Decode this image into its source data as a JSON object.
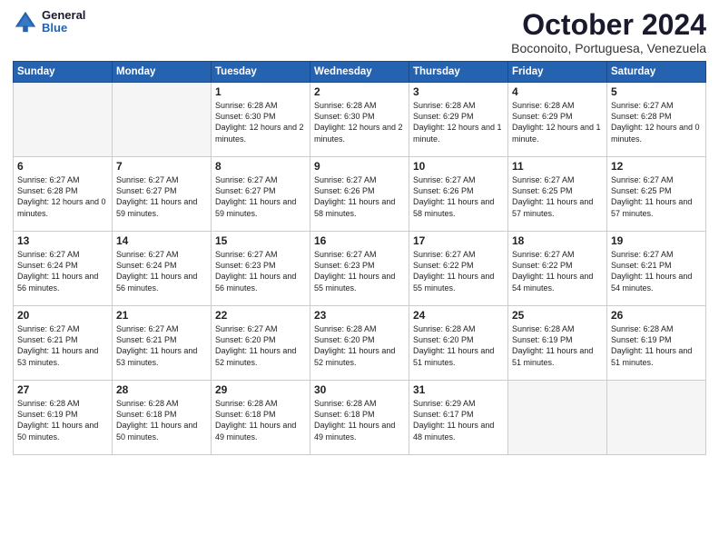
{
  "logo": {
    "general": "General",
    "blue": "Blue"
  },
  "header": {
    "month_title": "October 2024",
    "subtitle": "Boconoito, Portuguesa, Venezuela"
  },
  "days_of_week": [
    "Sunday",
    "Monday",
    "Tuesday",
    "Wednesday",
    "Thursday",
    "Friday",
    "Saturday"
  ],
  "weeks": [
    [
      {
        "day": "",
        "info": ""
      },
      {
        "day": "",
        "info": ""
      },
      {
        "day": "1",
        "info": "Sunrise: 6:28 AM\nSunset: 6:30 PM\nDaylight: 12 hours and 2 minutes."
      },
      {
        "day": "2",
        "info": "Sunrise: 6:28 AM\nSunset: 6:30 PM\nDaylight: 12 hours and 2 minutes."
      },
      {
        "day": "3",
        "info": "Sunrise: 6:28 AM\nSunset: 6:29 PM\nDaylight: 12 hours and 1 minute."
      },
      {
        "day": "4",
        "info": "Sunrise: 6:28 AM\nSunset: 6:29 PM\nDaylight: 12 hours and 1 minute."
      },
      {
        "day": "5",
        "info": "Sunrise: 6:27 AM\nSunset: 6:28 PM\nDaylight: 12 hours and 0 minutes."
      }
    ],
    [
      {
        "day": "6",
        "info": "Sunrise: 6:27 AM\nSunset: 6:28 PM\nDaylight: 12 hours and 0 minutes."
      },
      {
        "day": "7",
        "info": "Sunrise: 6:27 AM\nSunset: 6:27 PM\nDaylight: 11 hours and 59 minutes."
      },
      {
        "day": "8",
        "info": "Sunrise: 6:27 AM\nSunset: 6:27 PM\nDaylight: 11 hours and 59 minutes."
      },
      {
        "day": "9",
        "info": "Sunrise: 6:27 AM\nSunset: 6:26 PM\nDaylight: 11 hours and 58 minutes."
      },
      {
        "day": "10",
        "info": "Sunrise: 6:27 AM\nSunset: 6:26 PM\nDaylight: 11 hours and 58 minutes."
      },
      {
        "day": "11",
        "info": "Sunrise: 6:27 AM\nSunset: 6:25 PM\nDaylight: 11 hours and 57 minutes."
      },
      {
        "day": "12",
        "info": "Sunrise: 6:27 AM\nSunset: 6:25 PM\nDaylight: 11 hours and 57 minutes."
      }
    ],
    [
      {
        "day": "13",
        "info": "Sunrise: 6:27 AM\nSunset: 6:24 PM\nDaylight: 11 hours and 56 minutes."
      },
      {
        "day": "14",
        "info": "Sunrise: 6:27 AM\nSunset: 6:24 PM\nDaylight: 11 hours and 56 minutes."
      },
      {
        "day": "15",
        "info": "Sunrise: 6:27 AM\nSunset: 6:23 PM\nDaylight: 11 hours and 56 minutes."
      },
      {
        "day": "16",
        "info": "Sunrise: 6:27 AM\nSunset: 6:23 PM\nDaylight: 11 hours and 55 minutes."
      },
      {
        "day": "17",
        "info": "Sunrise: 6:27 AM\nSunset: 6:22 PM\nDaylight: 11 hours and 55 minutes."
      },
      {
        "day": "18",
        "info": "Sunrise: 6:27 AM\nSunset: 6:22 PM\nDaylight: 11 hours and 54 minutes."
      },
      {
        "day": "19",
        "info": "Sunrise: 6:27 AM\nSunset: 6:21 PM\nDaylight: 11 hours and 54 minutes."
      }
    ],
    [
      {
        "day": "20",
        "info": "Sunrise: 6:27 AM\nSunset: 6:21 PM\nDaylight: 11 hours and 53 minutes."
      },
      {
        "day": "21",
        "info": "Sunrise: 6:27 AM\nSunset: 6:21 PM\nDaylight: 11 hours and 53 minutes."
      },
      {
        "day": "22",
        "info": "Sunrise: 6:27 AM\nSunset: 6:20 PM\nDaylight: 11 hours and 52 minutes."
      },
      {
        "day": "23",
        "info": "Sunrise: 6:28 AM\nSunset: 6:20 PM\nDaylight: 11 hours and 52 minutes."
      },
      {
        "day": "24",
        "info": "Sunrise: 6:28 AM\nSunset: 6:20 PM\nDaylight: 11 hours and 51 minutes."
      },
      {
        "day": "25",
        "info": "Sunrise: 6:28 AM\nSunset: 6:19 PM\nDaylight: 11 hours and 51 minutes."
      },
      {
        "day": "26",
        "info": "Sunrise: 6:28 AM\nSunset: 6:19 PM\nDaylight: 11 hours and 51 minutes."
      }
    ],
    [
      {
        "day": "27",
        "info": "Sunrise: 6:28 AM\nSunset: 6:19 PM\nDaylight: 11 hours and 50 minutes."
      },
      {
        "day": "28",
        "info": "Sunrise: 6:28 AM\nSunset: 6:18 PM\nDaylight: 11 hours and 50 minutes."
      },
      {
        "day": "29",
        "info": "Sunrise: 6:28 AM\nSunset: 6:18 PM\nDaylight: 11 hours and 49 minutes."
      },
      {
        "day": "30",
        "info": "Sunrise: 6:28 AM\nSunset: 6:18 PM\nDaylight: 11 hours and 49 minutes."
      },
      {
        "day": "31",
        "info": "Sunrise: 6:29 AM\nSunset: 6:17 PM\nDaylight: 11 hours and 48 minutes."
      },
      {
        "day": "",
        "info": ""
      },
      {
        "day": "",
        "info": ""
      }
    ]
  ]
}
